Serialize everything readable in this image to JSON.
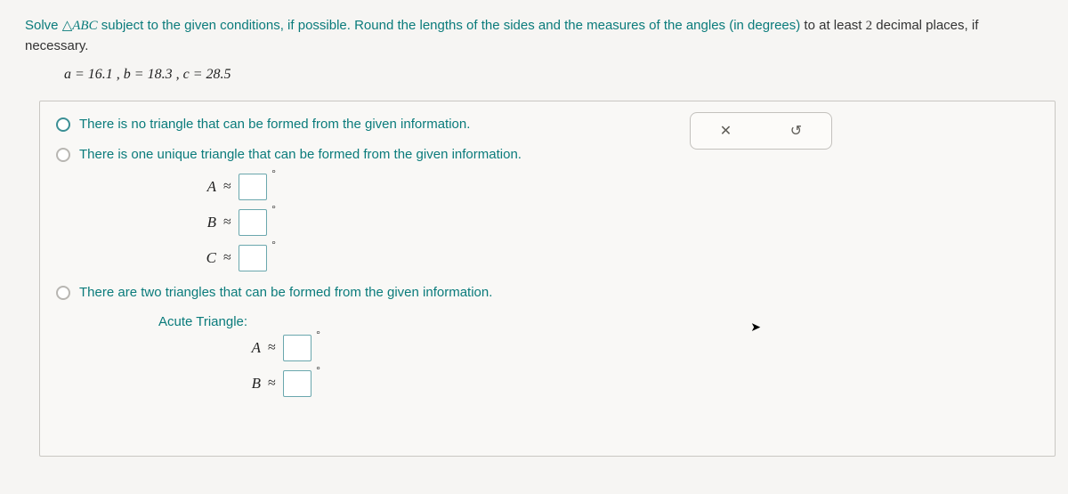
{
  "prompt": {
    "part1": "Solve ",
    "triangle": "△",
    "abc": "ABC",
    "part2": " subject to the given conditions, if possible. Round the lengths of the sides and the measures of the angles (in degrees) ",
    "part3": "to at least ",
    "decnum": "2",
    "part4": " decimal places, if necessary."
  },
  "given": "a = 16.1 ,  b = 18.3 ,  c = 28.5",
  "options": {
    "opt1": "There is no triangle that can be formed from the given information.",
    "opt2": "There is one unique triangle that can be formed from the given information.",
    "opt3": "There are two triangles that can be formed from the given information.",
    "acute": "Acute Triangle:"
  },
  "vars": {
    "A": "A",
    "B": "B",
    "C": "C",
    "approx": "≈",
    "deg": "°"
  },
  "actions": {
    "clear": "✕",
    "reset": "↺"
  }
}
